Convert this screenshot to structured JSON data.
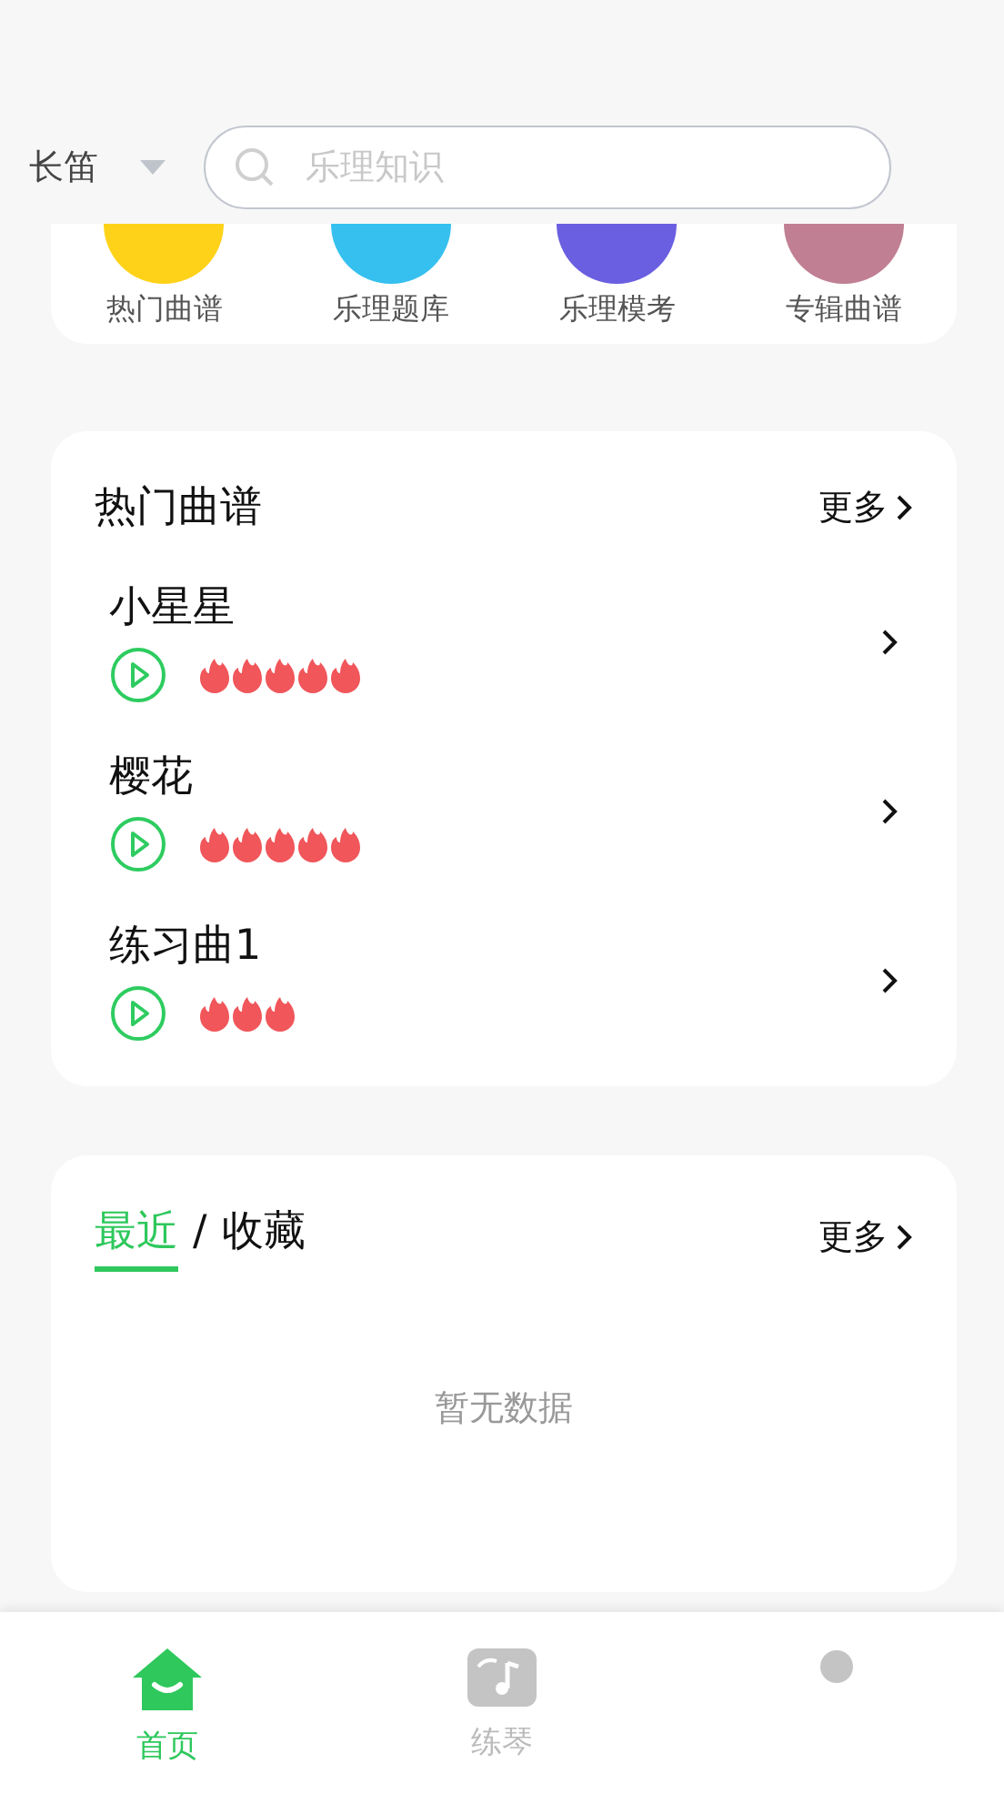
{
  "header": {
    "instrument": "长笛",
    "search": {
      "placeholder": "乐理知识"
    }
  },
  "shortcuts": [
    {
      "label": "热门曲谱",
      "color": "#ffd21a"
    },
    {
      "label": "乐理题库",
      "color": "#36c0f0"
    },
    {
      "label": "乐理模考",
      "color": "#6a5fe0"
    },
    {
      "label": "专辑曲谱",
      "color": "#c07f93"
    }
  ],
  "hot": {
    "title": "热门曲谱",
    "more": "更多",
    "songs": [
      {
        "name": "小星星",
        "stars": 5
      },
      {
        "name": "樱花",
        "stars": 5
      },
      {
        "name": "练习曲1",
        "stars": 3
      }
    ]
  },
  "recent": {
    "tabs": [
      {
        "label": "最近",
        "selected": true
      },
      {
        "label": "收藏",
        "selected": false
      }
    ],
    "separator": "/",
    "more": "更多",
    "empty": "暂无数据"
  },
  "nav": [
    {
      "label": "首页",
      "kind": "home",
      "selected": true
    },
    {
      "label": "练琴",
      "kind": "practice",
      "selected": false
    },
    {
      "kind": "profile",
      "selected": false
    }
  ]
}
